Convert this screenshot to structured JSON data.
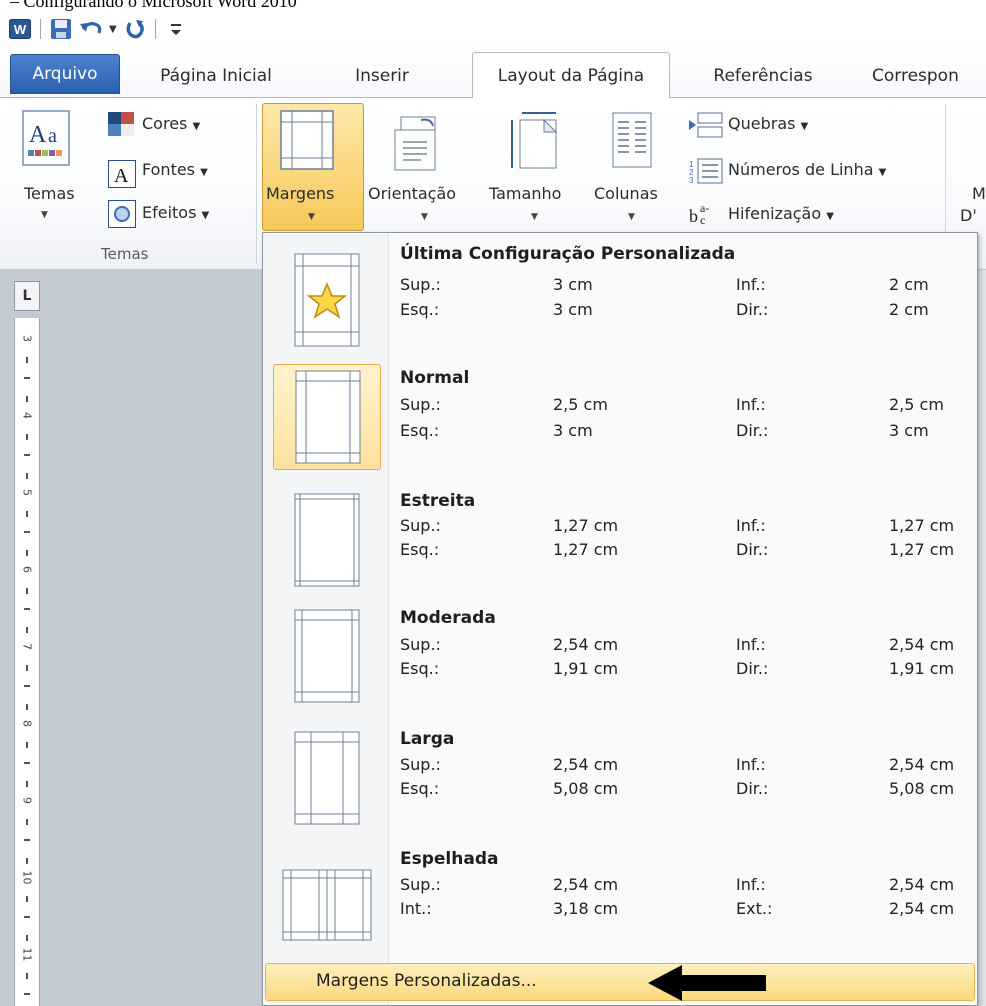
{
  "caption": "– Configurando o Microsoft Word 2010",
  "quick_access": {
    "word_icon": "word-app-icon",
    "save_icon": "save-icon",
    "undo_icon": "undo-icon",
    "redo_icon": "redo-icon",
    "customize_icon": "customize-toolbar-icon"
  },
  "tabs": {
    "file": "Arquivo",
    "home": "Página Inicial",
    "insert": "Inserir",
    "layout": "Layout da Página",
    "references": "Referências",
    "mailings": "Correspon"
  },
  "ribbon": {
    "themes_group_label": "Temas",
    "themes_button": "Temas",
    "colors": "Cores",
    "fonts": "Fontes",
    "effects": "Efeitos",
    "margins": "Margens",
    "orientation": "Orientação",
    "size": "Tamanho",
    "columns": "Colunas",
    "breaks": "Quebras",
    "line_numbers": "Números de Linha",
    "hyphenation": "Hifenização",
    "cut_label_1": "M",
    "cut_label_2": "D'"
  },
  "ruler": {
    "tab_selector": "L",
    "numbers": [
      "3",
      "4",
      "5",
      "6",
      "7",
      "8",
      "9",
      "10",
      "11"
    ]
  },
  "margins_menu": {
    "items": [
      {
        "title": "Última Configuração Personalizada",
        "l1": "Sup.:",
        "v1": "3 cm",
        "l2": "Inf.:",
        "v2": "2 cm",
        "l3": "Esq.:",
        "v3": "3 cm",
        "l4": "Dir.:",
        "v4": "2 cm",
        "selected": false
      },
      {
        "title": "Normal",
        "l1": "Sup.:",
        "v1": "2,5 cm",
        "l2": "Inf.:",
        "v2": "2,5 cm",
        "l3": "Esq.:",
        "v3": "3 cm",
        "l4": "Dir.:",
        "v4": "3 cm",
        "selected": true
      },
      {
        "title": "Estreita",
        "l1": "Sup.:",
        "v1": "1,27 cm",
        "l2": "Inf.:",
        "v2": "1,27 cm",
        "l3": "Esq.:",
        "v3": "1,27 cm",
        "l4": "Dir.:",
        "v4": "1,27 cm",
        "selected": false
      },
      {
        "title": "Moderada",
        "l1": "Sup.:",
        "v1": "2,54 cm",
        "l2": "Inf.:",
        "v2": "2,54 cm",
        "l3": "Esq.:",
        "v3": "1,91 cm",
        "l4": "Dir.:",
        "v4": "1,91 cm",
        "selected": false
      },
      {
        "title": "Larga",
        "l1": "Sup.:",
        "v1": "2,54 cm",
        "l2": "Inf.:",
        "v2": "2,54 cm",
        "l3": "Esq.:",
        "v3": "5,08 cm",
        "l4": "Dir.:",
        "v4": "5,08 cm",
        "selected": false
      },
      {
        "title": "Espelhada",
        "l1": "Sup.:",
        "v1": "2,54 cm",
        "l2": "Inf.:",
        "v2": "2,54 cm",
        "l3": "Int.:",
        "v3": "3,18 cm",
        "l4": "Ext.:",
        "v4": "2,54 cm",
        "selected": false
      }
    ],
    "custom_margins": "Margens Personalizadas..."
  },
  "colors": {
    "file_tab": "#2a5fae",
    "highlight": "#f7c859",
    "highlight_border": "#e9a94a",
    "document_bg": "#c4cad2"
  }
}
